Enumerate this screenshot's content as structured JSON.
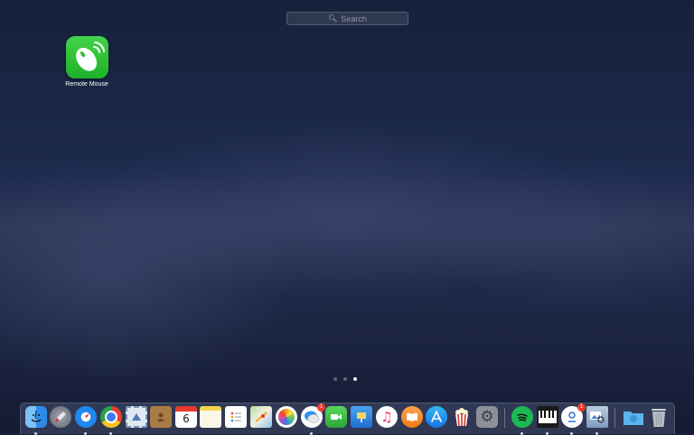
{
  "search": {
    "placeholder": "Search"
  },
  "launchpad": {
    "apps": [
      {
        "label": "Remote Mouse",
        "icon": "remote-mouse-icon"
      }
    ],
    "pages": {
      "total": 3,
      "current": 3
    }
  },
  "dock": {
    "items": [
      {
        "name": "finder",
        "icon": "finder-icon",
        "running": true,
        "badge": ""
      },
      {
        "name": "launchpad",
        "icon": "rocket-icon",
        "running": false,
        "badge": ""
      },
      {
        "name": "safari",
        "icon": "compass-icon",
        "running": true,
        "badge": ""
      },
      {
        "name": "chrome",
        "icon": "chrome-icon",
        "running": true,
        "badge": ""
      },
      {
        "name": "mail",
        "icon": "stamp-icon",
        "running": false,
        "badge": ""
      },
      {
        "name": "contacts",
        "icon": "address-book-icon",
        "running": false,
        "badge": ""
      },
      {
        "name": "calendar",
        "icon": "calendar-icon",
        "running": false,
        "badge": "",
        "text": "6"
      },
      {
        "name": "notes",
        "icon": "notes-icon",
        "running": false,
        "badge": ""
      },
      {
        "name": "reminders",
        "icon": "checklist-icon",
        "running": false,
        "badge": ""
      },
      {
        "name": "maps",
        "icon": "map-icon",
        "running": false,
        "badge": ""
      },
      {
        "name": "photos",
        "icon": "photos-flower-icon",
        "running": false,
        "badge": ""
      },
      {
        "name": "messages",
        "icon": "chat-bubbles-icon",
        "running": true,
        "badge": "1"
      },
      {
        "name": "facetime",
        "icon": "video-camera-icon",
        "running": false,
        "badge": ""
      },
      {
        "name": "keynote",
        "icon": "presentation-icon",
        "running": false,
        "badge": ""
      },
      {
        "name": "itunes",
        "icon": "music-note-icon",
        "running": false,
        "badge": ""
      },
      {
        "name": "ibooks",
        "icon": "open-book-icon",
        "running": false,
        "badge": ""
      },
      {
        "name": "app-store",
        "icon": "app-store-icon",
        "running": false,
        "badge": ""
      },
      {
        "name": "popcorn-time",
        "icon": "popcorn-icon",
        "running": false,
        "badge": ""
      },
      {
        "name": "system-preferences",
        "icon": "gear-icon",
        "running": false,
        "badge": ""
      },
      {
        "name": "spotify",
        "icon": "spotify-icon",
        "running": true,
        "badge": ""
      },
      {
        "name": "piano",
        "icon": "piano-keys-icon",
        "running": true,
        "badge": ""
      },
      {
        "name": "messenger",
        "icon": "profile-badge-icon",
        "running": true,
        "badge": "1"
      },
      {
        "name": "preview",
        "icon": "preview-photos-icon",
        "running": true,
        "badge": ""
      },
      {
        "name": "downloads-folder",
        "icon": "folder-icon",
        "running": false,
        "badge": ""
      },
      {
        "name": "trash",
        "icon": "trash-icon",
        "running": false,
        "badge": ""
      }
    ]
  }
}
